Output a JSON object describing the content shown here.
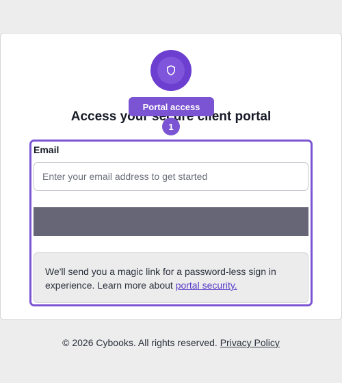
{
  "header": {
    "title": "Access your secure client portal",
    "logo_icon": "shield-icon"
  },
  "tooltip": {
    "label": "Portal access",
    "step_number": "1"
  },
  "form": {
    "email_label": "Email",
    "email_placeholder": "Enter your email address to get started",
    "email_value": "",
    "submit_label": ""
  },
  "info": {
    "text": "We'll send you a magic link for a password-less sign in experience. Learn more about ",
    "link_text": "portal security."
  },
  "footer": {
    "copyright": "© 2026 Cybooks. All rights reserved. ",
    "privacy_link": "Privacy Policy"
  },
  "colors": {
    "accent": "#7b54d3",
    "logo": "#6d3fd0",
    "button": "#676676",
    "background": "#ededed"
  }
}
